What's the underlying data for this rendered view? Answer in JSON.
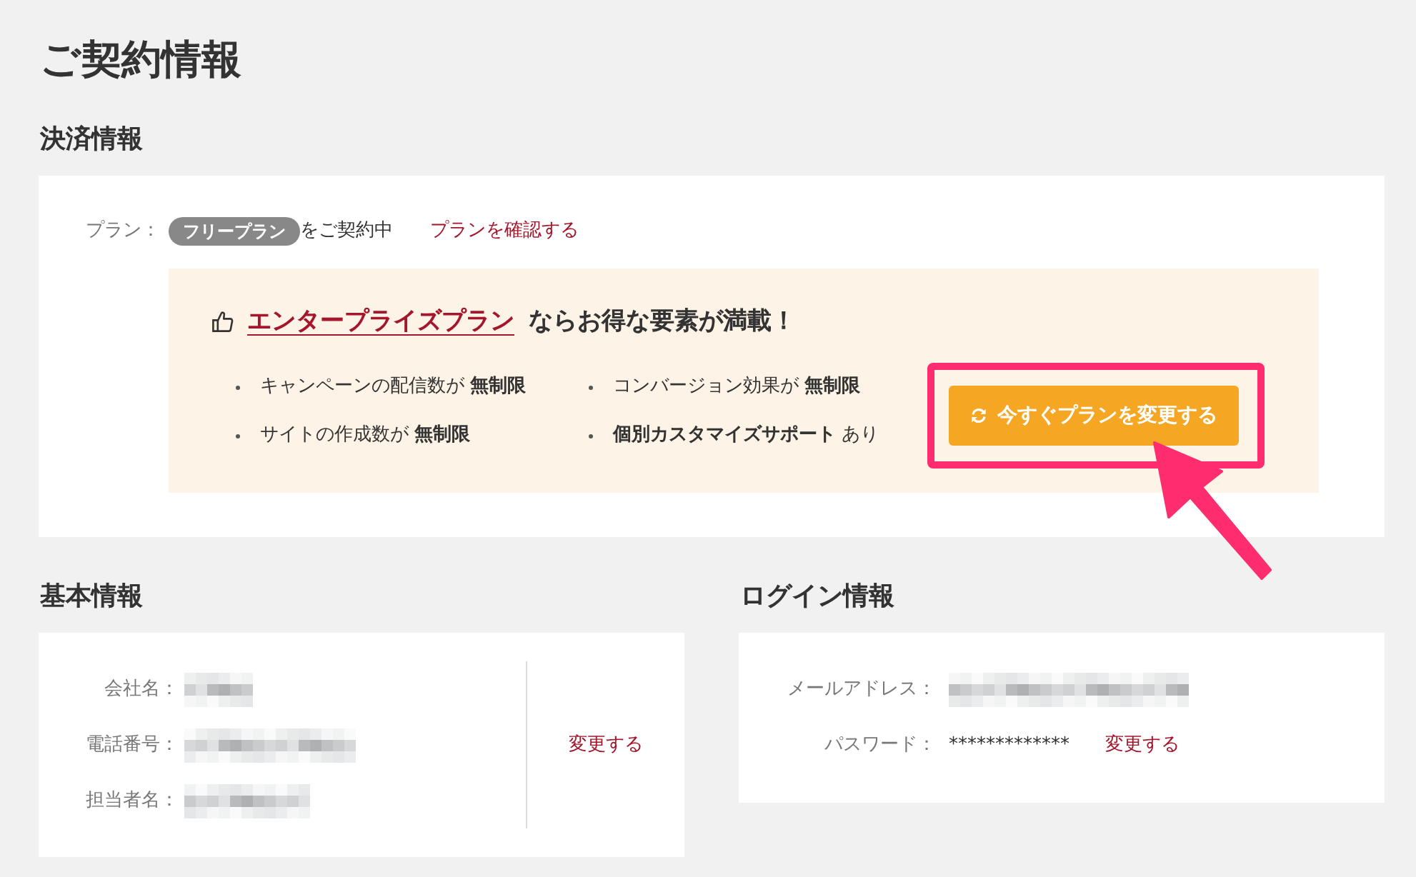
{
  "page_title": "ご契約情報",
  "billing": {
    "heading": "決済情報",
    "plan": {
      "label": "プラン：",
      "badge": "フリープラン",
      "status": "をご契約中",
      "link": "プランを確認する"
    },
    "promo": {
      "link": "エンタープライズプラン",
      "headline": "ならお得な要素が満載！",
      "features": [
        {
          "text": "キャンペーンの配信数が **無制限**"
        },
        {
          "text": "コンバージョン効果が **無制限**"
        },
        {
          "text": "サイトの作成数が **無制限**"
        },
        {
          "text": "**個別カスタマイズサポート** あり"
        }
      ],
      "button": {
        "label": "今すぐプランを変更する",
        "highlighted": true,
        "pointed_at": true
      }
    }
  },
  "basic_info": {
    "heading": "基本情報",
    "fields": [
      {
        "label": "会社名：",
        "redacted": true
      },
      {
        "label": "電話番号：",
        "redacted": true
      },
      {
        "label": "担当者名：",
        "redacted": true
      }
    ],
    "link": "変更する"
  },
  "login_info": {
    "heading": "ログイン情報",
    "fields": [
      {
        "label": "メールアドレス：",
        "redacted": true
      },
      {
        "label": "パスワード：",
        "value": "*************",
        "link": "変更する"
      }
    ]
  }
}
